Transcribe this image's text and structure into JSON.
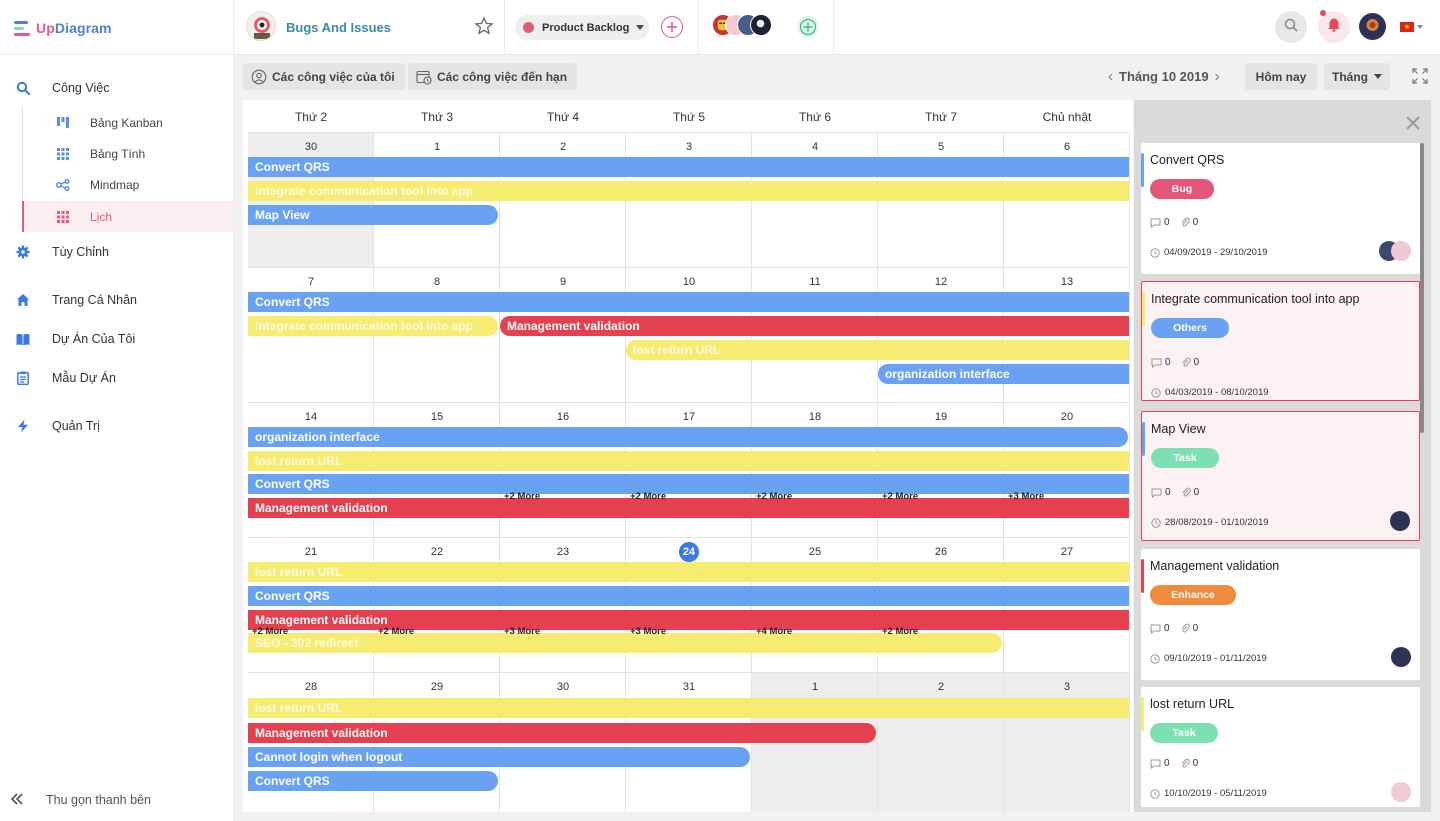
{
  "app": {
    "logo_up": "Up",
    "logo_diagram": "Diagram"
  },
  "sidebar": {
    "main": [
      {
        "label": "Công Việc",
        "icon": "search-icon"
      },
      {
        "label": "Tùy Chỉnh",
        "icon": "gear-icon"
      },
      {
        "label": "Trang Cá Nhân",
        "icon": "home-icon"
      },
      {
        "label": "Dự Án Của Tôi",
        "icon": "book-icon"
      },
      {
        "label": "Mẫu Dự Án",
        "icon": "clipboard-icon"
      },
      {
        "label": "Quản Trị",
        "icon": "bolt-icon"
      }
    ],
    "sub": [
      {
        "label": "Bảng Kanban",
        "icon": "kanban-icon"
      },
      {
        "label": "Bảng Tính",
        "icon": "spreadsheet-icon"
      },
      {
        "label": "Mindmap",
        "icon": "mindmap-icon"
      },
      {
        "label": "Lịch",
        "icon": "calendar-icon",
        "active": true
      }
    ],
    "collapse_label": "Thu gọn thanh bên"
  },
  "header": {
    "project_title": "Bugs And Issues",
    "backlog_label": "Product Backlog"
  },
  "toolbar": {
    "my_tasks": "Các công việc của tôi",
    "due_tasks": "Các công việc đến hạn",
    "month_label": "Tháng 10 2019",
    "today": "Hôm nay",
    "view": "Tháng"
  },
  "calendar": {
    "weekdays": [
      "Thứ 2",
      "Thứ 3",
      "Thứ 4",
      "Thứ 5",
      "Thứ 6",
      "Thứ 7",
      "Chủ nhật"
    ],
    "weeks": [
      {
        "days": [
          "30",
          "1",
          "2",
          "3",
          "4",
          "5",
          "6"
        ],
        "out": [
          true,
          false,
          false,
          false,
          false,
          false,
          false
        ],
        "events": [
          {
            "title": "Convert QRS",
            "color": "blue",
            "start": 0,
            "end": 6,
            "row": 0
          },
          {
            "title": "Integrate communication tool into app",
            "color": "yellow",
            "start": 0,
            "end": 6,
            "row": 1
          },
          {
            "title": "Map View",
            "color": "blue",
            "start": 0,
            "end": 1,
            "row": 2,
            "ends": true
          }
        ],
        "more": []
      },
      {
        "days": [
          "7",
          "8",
          "9",
          "10",
          "11",
          "12",
          "13"
        ],
        "out": [
          false,
          false,
          false,
          false,
          false,
          false,
          false
        ],
        "events": [
          {
            "title": "Convert QRS",
            "color": "blue",
            "start": 0,
            "end": 6,
            "row": 0
          },
          {
            "title": "Integrate communication tool into app",
            "color": "yellow",
            "start": 0,
            "end": 1,
            "row": 1,
            "ends": true
          },
          {
            "title": "Management validation",
            "color": "red",
            "start": 2,
            "end": 6,
            "row": 1,
            "starts": true
          },
          {
            "title": "lost return URL",
            "color": "yellow",
            "start": 3,
            "end": 6,
            "row": 2,
            "starts": true
          },
          {
            "title": "organization interface",
            "color": "blue",
            "start": 5,
            "end": 6,
            "row": 3,
            "starts": true
          }
        ],
        "more": []
      },
      {
        "days": [
          "14",
          "15",
          "16",
          "17",
          "18",
          "19",
          "20"
        ],
        "out": [
          false,
          false,
          false,
          false,
          false,
          false,
          false
        ],
        "events": [
          {
            "title": "organization interface",
            "color": "blue",
            "start": 0,
            "end": 6,
            "row": 0,
            "ends": true
          },
          {
            "title": "lost return URL",
            "color": "yellow",
            "start": 0,
            "end": 6,
            "row": 1
          },
          {
            "title": "Convert QRS",
            "color": "blue",
            "start": 0,
            "end": 6,
            "row": 2
          },
          {
            "title": "Management validation",
            "color": "red",
            "start": 0,
            "end": 6,
            "row": 3
          }
        ],
        "more": [
          null,
          null,
          "+2 More",
          "+2 More",
          "+2 More",
          "+2 More",
          "+3 More"
        ]
      },
      {
        "days": [
          "21",
          "22",
          "23",
          "24",
          "25",
          "26",
          "27"
        ],
        "out": [
          false,
          false,
          false,
          false,
          false,
          false,
          false
        ],
        "today": 3,
        "events": [
          {
            "title": "lost return URL",
            "color": "yellow",
            "start": 0,
            "end": 6,
            "row": 0
          },
          {
            "title": "Convert QRS",
            "color": "blue",
            "start": 0,
            "end": 6,
            "row": 1
          },
          {
            "title": "Management validation",
            "color": "red",
            "start": 0,
            "end": 6,
            "row": 2
          },
          {
            "title": "SEO - 302 redirect",
            "color": "yellow",
            "start": 0,
            "end": 5,
            "row": 3,
            "ends": true
          }
        ],
        "more": [
          "+2 More",
          "+2 More",
          "+3 More",
          "+3 More",
          "+4 More",
          "+2 More",
          null
        ]
      },
      {
        "days": [
          "28",
          "29",
          "30",
          "31",
          "1",
          "2",
          "3"
        ],
        "out": [
          false,
          false,
          false,
          false,
          true,
          true,
          true
        ],
        "events": [
          {
            "title": "lost return URL",
            "color": "yellow",
            "start": 0,
            "end": 6,
            "row": 0
          },
          {
            "title": "Management validation",
            "color": "red",
            "start": 0,
            "end": 4,
            "row": 1,
            "ends": true
          },
          {
            "title": "Cannot login when logout",
            "color": "blue",
            "start": 0,
            "end": 3,
            "row": 2,
            "ends": true
          },
          {
            "title": "Convert QRS",
            "color": "blue",
            "start": 0,
            "end": 1,
            "row": 3,
            "ends": true
          }
        ],
        "more": []
      }
    ]
  },
  "panel": {
    "cards": [
      {
        "title": "Convert QRS",
        "tag": "Bug",
        "tag_color": "#e4557a",
        "bar_color": "#6aa2f3",
        "comments": "0",
        "attachments": "0",
        "dates": "04/09/2019 - 29/10/2019",
        "highlight": false,
        "avatars": 2
      },
      {
        "title": "Integrate communication tool into app",
        "tag": "Others",
        "tag_color": "#6aa2f3",
        "bar_color": "#f7ec72",
        "comments": "0",
        "attachments": "0",
        "dates": "04/03/2019 - 08/10/2019",
        "highlight": true,
        "avatars": 0
      },
      {
        "title": "Map View",
        "tag": "Task",
        "tag_color": "#7de0b2",
        "bar_color": "#6aa2f3",
        "comments": "0",
        "attachments": "0",
        "dates": "28/08/2019 - 01/10/2019",
        "highlight": true,
        "avatars": 1
      },
      {
        "title": "Management validation",
        "tag": "Enhance",
        "tag_color": "#f08a3c",
        "bar_color": "#e4404f",
        "comments": "0",
        "attachments": "0",
        "dates": "09/10/2019 - 01/11/2019",
        "highlight": false,
        "avatars": 1
      },
      {
        "title": "lost return URL",
        "tag": "Task",
        "tag_color": "#7de0b2",
        "bar_color": "#f7ec72",
        "comments": "0",
        "attachments": "0",
        "dates": "10/10/2019 - 05/11/2019",
        "highlight": false,
        "avatars": 1
      }
    ]
  }
}
